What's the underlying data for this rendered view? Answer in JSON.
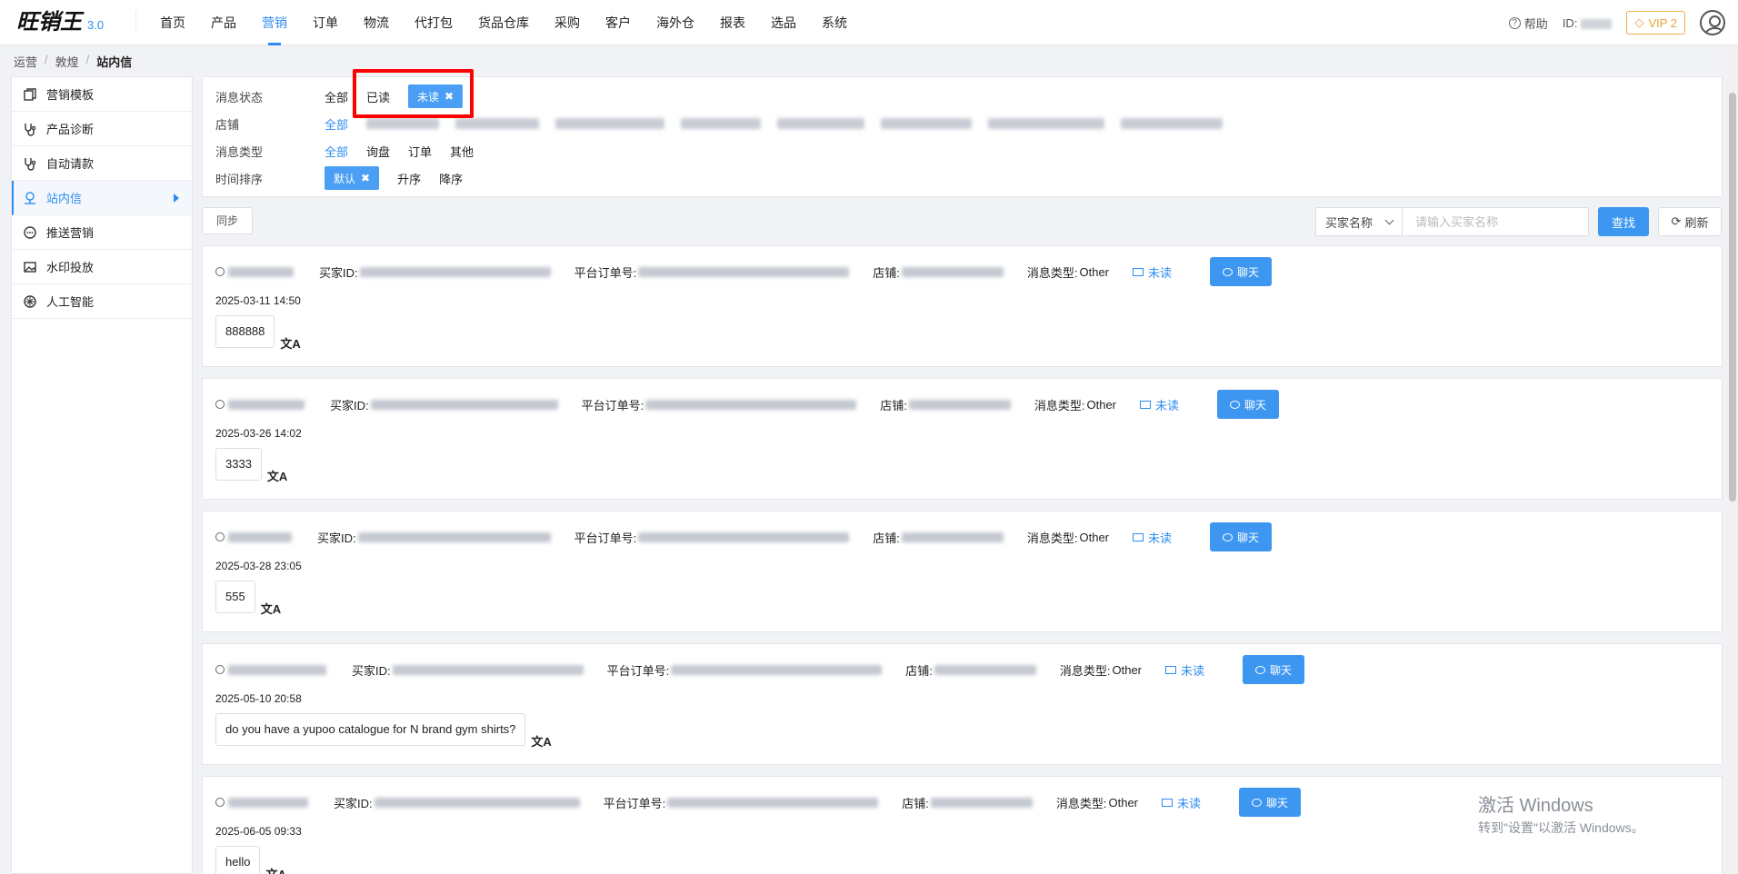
{
  "logo": {
    "name": "旺销王",
    "version": "3.0"
  },
  "nav": {
    "items": [
      "首页",
      "产品",
      "营销",
      "订单",
      "物流",
      "代打包",
      "货品仓库",
      "采购",
      "客户",
      "海外仓",
      "报表",
      "选品",
      "系统"
    ],
    "active_index": 2,
    "help": "帮助",
    "id_label": "ID:",
    "vip": "VIP 2",
    "accent": "#2d8cf0"
  },
  "breadcrumb": [
    "运营",
    "敦煌",
    "站内信"
  ],
  "sidebar": {
    "items": [
      {
        "label": "营销模板",
        "icon": "copy-icon"
      },
      {
        "label": "产品诊断",
        "icon": "stethoscope-icon"
      },
      {
        "label": "自动请款",
        "icon": "stethoscope-icon"
      },
      {
        "label": "站内信",
        "icon": "message-icon",
        "active": true
      },
      {
        "label": "推送营销",
        "icon": "chat-icon"
      },
      {
        "label": "水印投放",
        "icon": "image-icon"
      },
      {
        "label": "人工智能",
        "icon": "ai-icon"
      }
    ]
  },
  "filters": {
    "status": {
      "label": "消息状态",
      "options": [
        "全部",
        "已读",
        "未读"
      ],
      "selected": "未读"
    },
    "shop": {
      "label": "店铺",
      "all": "全部"
    },
    "type": {
      "label": "消息类型",
      "options": [
        "全部",
        "询盘",
        "订单",
        "其他"
      ],
      "selected": "全部"
    },
    "sort": {
      "label": "时间排序",
      "options": [
        "默认",
        "升序",
        "降序"
      ],
      "selected": "默认"
    }
  },
  "toolbar": {
    "sync": "同步",
    "search_field": "买家名称",
    "search_placeholder": "请输入买家名称",
    "find": "查找",
    "refresh": "刷新"
  },
  "labels": {
    "buyer_id": "买家ID:",
    "order_no": "平台订单号:",
    "shop": "店铺:",
    "msg_type": "消息类型:",
    "chat": "聊天"
  },
  "messages": [
    {
      "type": "Other",
      "status": "未读",
      "time": "2025-03-11 14:50",
      "content": "888888"
    },
    {
      "type": "Other",
      "status": "未读",
      "time": "2025-03-26 14:02",
      "content": "3333"
    },
    {
      "type": "Other",
      "status": "未读",
      "time": "2025-03-28 23:05",
      "content": "555"
    },
    {
      "type": "Other",
      "status": "未读",
      "time": "2025-05-10 20:58",
      "content": "do you have a yupoo catalogue for N brand gym shirts?"
    },
    {
      "type": "Other",
      "status": "未读",
      "time": "2025-06-05 09:33",
      "content": "hello"
    }
  ],
  "watermark": {
    "line1": "激活 Windows",
    "line2": "转到\"设置\"以激活 Windows。"
  }
}
